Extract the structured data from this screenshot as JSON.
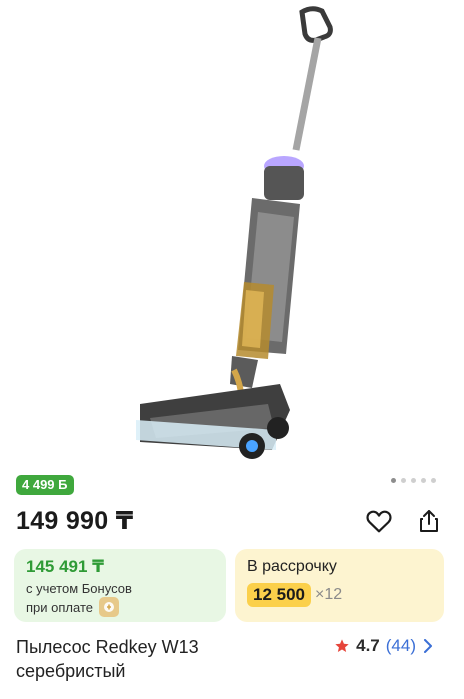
{
  "product": {
    "bonus_badge": "4 499 Б",
    "price": "149 990 ₸",
    "bonus_price": "145 491 ₸",
    "bonus_caption_line1": "с учетом Бонусов",
    "bonus_caption_line2": "при оплате",
    "installment_title": "В рассрочку",
    "installment_amount": "12 500",
    "installment_times": "×12",
    "title_line1": "Пылесос Redkey W13",
    "title_line2": "серебристый",
    "rating": "4.7",
    "reviews": "(44)"
  },
  "icons": {
    "favorite": "heart-outline-icon",
    "share": "share-icon",
    "star": "star-icon",
    "chevron": "chevron-right-icon"
  },
  "colors": {
    "bonus_green": "#3fa83d",
    "installment_yellow": "#fbd04b",
    "link_blue": "#3b6fd6",
    "star_red": "#e6453a"
  }
}
